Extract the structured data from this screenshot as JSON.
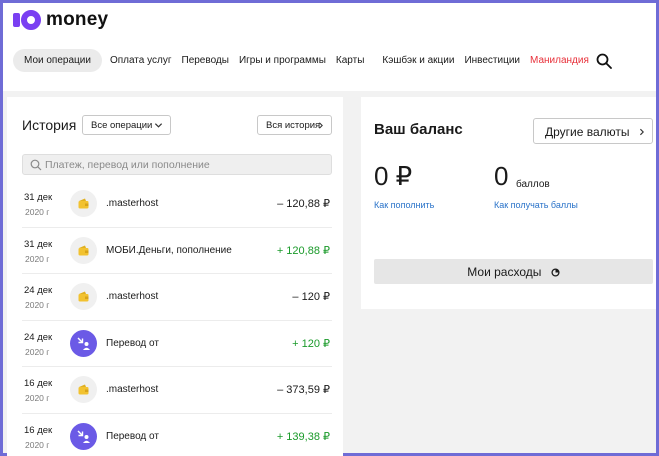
{
  "brand": {
    "name": "money"
  },
  "nav": {
    "items": [
      {
        "label": "Мои операции",
        "active": true
      },
      {
        "label": "Оплата услуг"
      },
      {
        "label": "Переводы"
      },
      {
        "label": "Игры и программы"
      },
      {
        "label": "Карты"
      },
      {
        "label": "Кэшбэк и акции"
      },
      {
        "label": "Инвестиции"
      },
      {
        "label": "Маниландия",
        "color": "#e8303a"
      }
    ],
    "search_icon": "search-icon"
  },
  "history": {
    "title": "История",
    "filter": {
      "selected": "Все операции"
    },
    "all_history_label": "Вся история",
    "search": {
      "placeholder": "Платеж, перевод или пополнение",
      "value": ""
    },
    "operations": [
      {
        "date": "31 дек",
        "year": "2020 г",
        "icon": "wallet-icon",
        "name": ".masterhost",
        "amount": "– 120,88 ₽",
        "type": "expense"
      },
      {
        "date": "31 дек",
        "year": "2020 г",
        "icon": "wallet-icon",
        "name": "МОБИ.Деньги, пополнение",
        "amount": "+ 120,88 ₽",
        "type": "income"
      },
      {
        "date": "24 дек",
        "year": "2020 г",
        "icon": "wallet-icon",
        "name": ".masterhost",
        "amount": "– 120 ₽",
        "type": "expense"
      },
      {
        "date": "24 дек",
        "year": "2020 г",
        "icon": "transfer-icon",
        "name": "Перевод от",
        "amount": "+ 120 ₽",
        "type": "income"
      },
      {
        "date": "16 дек",
        "year": "2020 г",
        "icon": "wallet-icon",
        "name": ".masterhost",
        "amount": "– 373,59 ₽",
        "type": "expense"
      },
      {
        "date": "16 дек",
        "year": "2020 г",
        "icon": "transfer-icon",
        "name": "Перевод от",
        "amount": "+ 139,38 ₽",
        "type": "income"
      }
    ]
  },
  "balance": {
    "title": "Ваш баланс",
    "other_currencies_label": "Другие валюты",
    "amount": "0 ₽",
    "top_up_link": "Как пополнить",
    "points_amount": "0",
    "points_label": "баллов",
    "points_link": "Как получать баллы",
    "expenses_label": "Мои расходы"
  },
  "colors": {
    "accent": "#7a3ff2",
    "income": "#1a9a2a",
    "link": "#2a73c9",
    "highlight": "#e8303a"
  }
}
